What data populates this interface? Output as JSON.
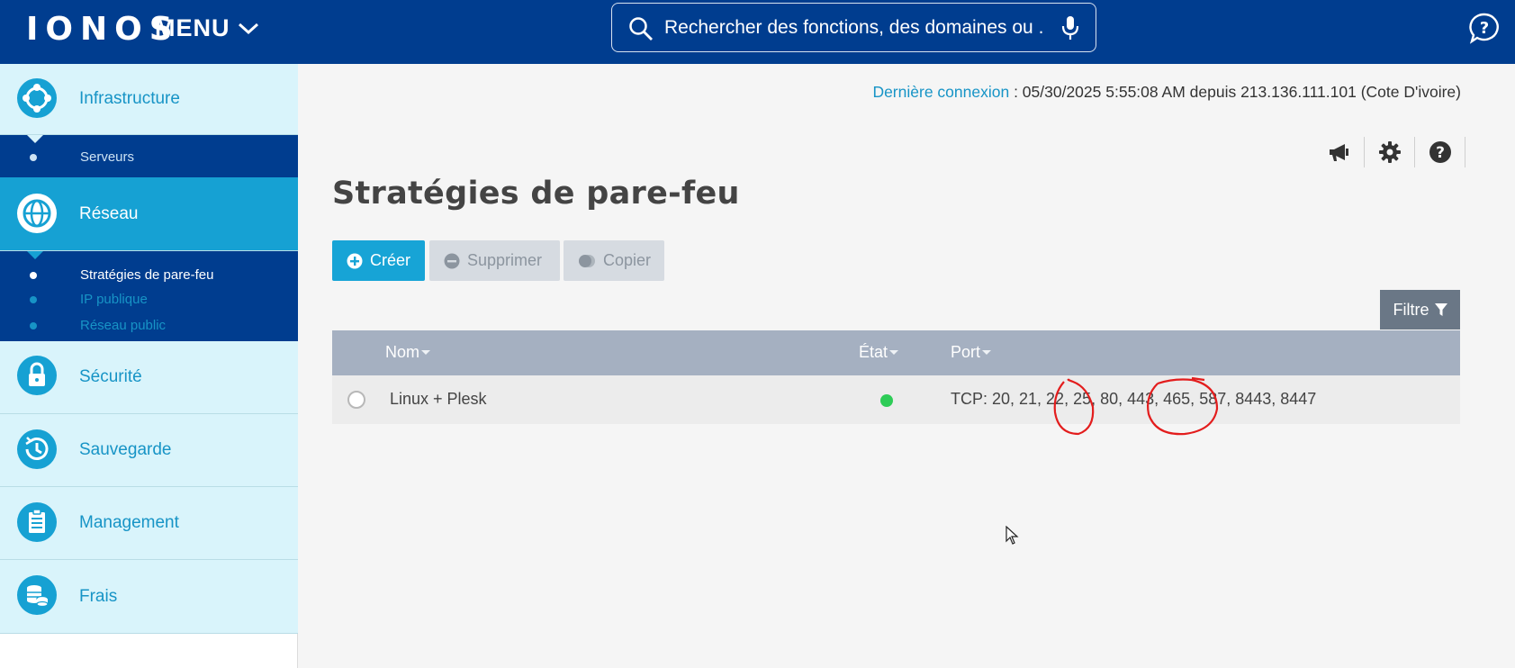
{
  "header": {
    "logo": "IONOS",
    "menu_label": "MENU",
    "search_placeholder": "Rechercher des fonctions, des domaines ou ...",
    "icons": [
      "search-icon",
      "microphone-icon",
      "help-chat-icon"
    ]
  },
  "sidebar": {
    "sections": [
      {
        "label": "Infrastructure",
        "icon": "infrastructure-icon",
        "active": false,
        "items": [
          {
            "label": "Serveurs"
          }
        ]
      },
      {
        "label": "Réseau",
        "icon": "network-globe-icon",
        "active": true,
        "items": [
          {
            "label": "Stratégies de pare-feu",
            "selected": true
          },
          {
            "label": "IP publique",
            "selected": false
          },
          {
            "label": "Réseau public",
            "selected": false
          }
        ]
      },
      {
        "label": "Sécurité",
        "icon": "lock-icon",
        "active": false
      },
      {
        "label": "Sauvegarde",
        "icon": "backup-clock-icon",
        "active": false
      },
      {
        "label": "Management",
        "icon": "clipboard-icon",
        "active": false
      },
      {
        "label": "Frais",
        "icon": "coins-icon",
        "active": false
      }
    ]
  },
  "last_login": {
    "link": "Dernière connexion",
    "text": " : 05/30/2025 5:55:08 AM depuis 213.136.111.101 (Cote D'ivoire)"
  },
  "toolbar_icons": [
    "megaphone-icon",
    "gear-icon",
    "help-icon"
  ],
  "page": {
    "title": "Stratégies de pare-feu"
  },
  "actions": {
    "create": "Créer",
    "delete": "Supprimer",
    "copy": "Copier",
    "filter": "Filtre"
  },
  "table": {
    "columns": {
      "name": "Nom",
      "state": "État",
      "port": "Port"
    },
    "rows": [
      {
        "name": "Linux + Plesk",
        "state": "active",
        "state_color": "#2ecc57",
        "port": "TCP: 20, 21, 22, 25, 80, 443, 465, 587, 8443, 8447"
      }
    ]
  },
  "colors": {
    "header": "#003d8f",
    "accent": "#16a1d3",
    "sidebar_light": "#d9f4fb",
    "annotation": "#e31d1d"
  }
}
